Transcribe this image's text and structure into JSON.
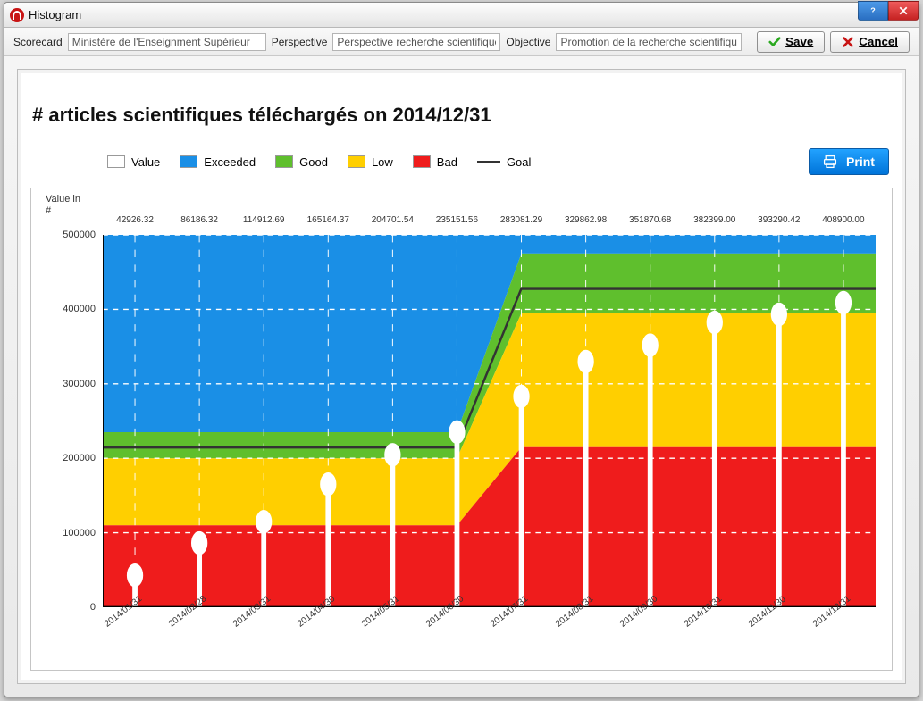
{
  "window": {
    "title": "Histogram"
  },
  "toolbar": {
    "scorecard_label": "Scorecard",
    "scorecard_value": "Ministère de l'Enseignment Supérieur",
    "perspective_label": "Perspective",
    "perspective_value": "Perspective recherche scientifique",
    "objective_label": "Objective",
    "objective_value": "Promotion de la recherche scientifique",
    "save_label": "Save",
    "cancel_label": "Cancel"
  },
  "chart": {
    "title": "# articles scientifiques téléchargés on 2014/12/31",
    "print_label": "Print",
    "y_axis_label_1": "Value in",
    "y_axis_label_2": "#"
  },
  "legend": {
    "value": {
      "label": "Value",
      "color": "#ffffff"
    },
    "exceeded": {
      "label": "Exceeded",
      "color": "#1a8fe6"
    },
    "good": {
      "label": "Good",
      "color": "#5fbf2d"
    },
    "low": {
      "label": "Low",
      "color": "#ffcf00"
    },
    "bad": {
      "label": "Bad",
      "color": "#ef1c1c"
    },
    "goal": {
      "label": "Goal",
      "color": "#333333"
    }
  },
  "chart_data": {
    "type": "bar",
    "ylabel": "Value in #",
    "ylim": [
      0,
      500000
    ],
    "yticks": [
      0,
      100000,
      200000,
      300000,
      400000,
      500000
    ],
    "categories": [
      "2014/01/31",
      "2014/02/28",
      "2014/03/31",
      "2014/04/30",
      "2014/05/31",
      "2014/06/30",
      "2014/07/31",
      "2014/08/31",
      "2014/09/30",
      "2014/10/31",
      "2014/11/30",
      "2014/12/31"
    ],
    "values": [
      42926.32,
      86186.32,
      114912.69,
      165164.37,
      204701.54,
      235151.56,
      283081.29,
      329862.98,
      351870.68,
      382399.0,
      393290.42,
      408900.0
    ],
    "goal": [
      215000,
      215000,
      215000,
      215000,
      215000,
      215000,
      428000,
      428000,
      428000,
      428000,
      428000,
      428000
    ],
    "bands": {
      "bad_upper": [
        110000,
        110000,
        110000,
        110000,
        110000,
        110000,
        215000,
        215000,
        215000,
        215000,
        215000,
        215000
      ],
      "low_upper": [
        200000,
        200000,
        200000,
        200000,
        200000,
        200000,
        395000,
        395000,
        395000,
        395000,
        395000,
        395000
      ],
      "good_upper": [
        235000,
        235000,
        235000,
        235000,
        235000,
        235000,
        475000,
        475000,
        475000,
        475000,
        475000,
        475000
      ],
      "exceeded_upper": [
        500000,
        500000,
        500000,
        500000,
        500000,
        500000,
        500000,
        500000,
        500000,
        500000,
        500000,
        500000
      ]
    }
  }
}
